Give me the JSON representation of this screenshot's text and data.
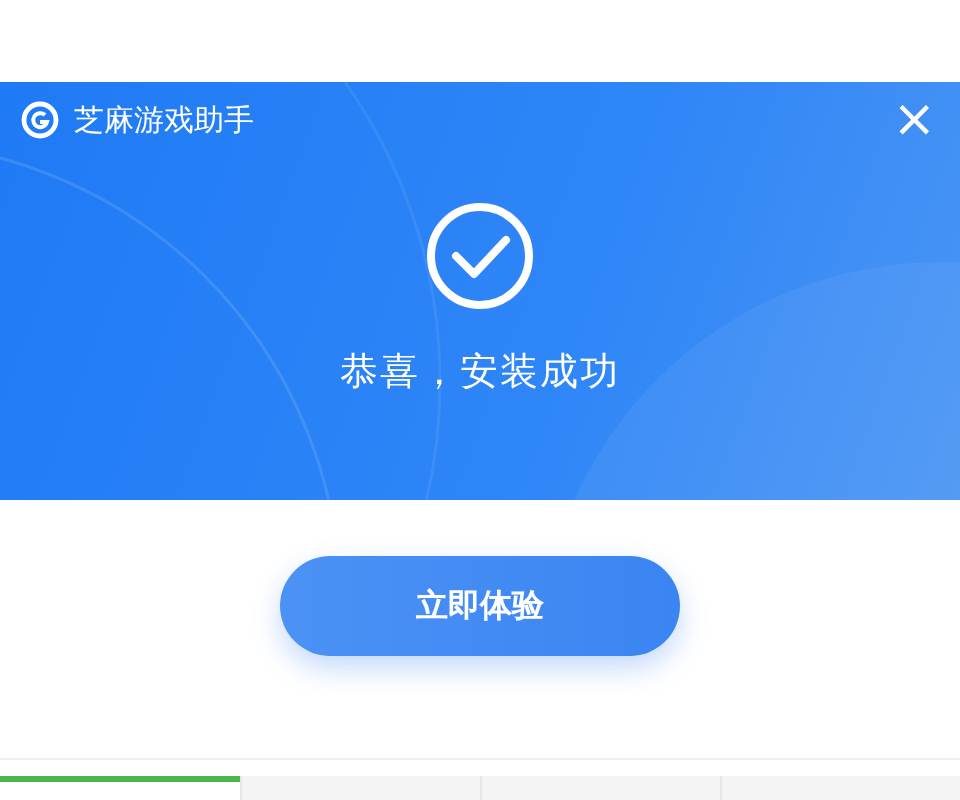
{
  "window": {
    "title": "芝麻游戏助手",
    "close": "×"
  },
  "message": "恭喜，安装成功",
  "button": "立即体验",
  "steps": [
    {
      "selected": true
    },
    {
      "selected": false
    },
    {
      "selected": false
    },
    {
      "selected": false
    }
  ]
}
